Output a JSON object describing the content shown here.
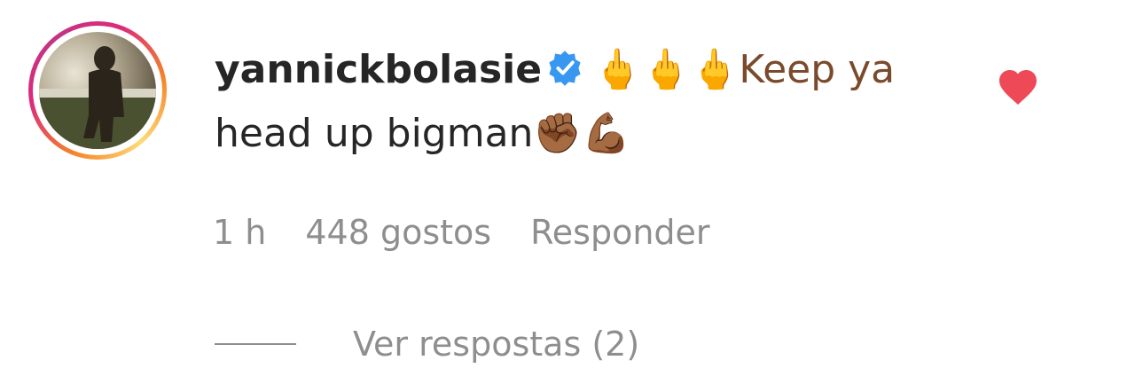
{
  "comment": {
    "username": "yannickbolasie",
    "verified": true,
    "text_part1": "🖕🖕🖕Keep ya",
    "text_part2": "head up bigman✊🏾💪🏾",
    "time": "1 h",
    "likes": "448 gostos",
    "reply_label": "Responder",
    "view_replies_label": "Ver respostas (2)",
    "liked": true
  },
  "colors": {
    "text": "#262626",
    "meta": "#8e8e8e",
    "verified_blue": "#3897f0",
    "heart_red": "#ed4956"
  },
  "icons": {
    "verified": "verified-badge-icon",
    "heart": "heart-filled-icon"
  }
}
